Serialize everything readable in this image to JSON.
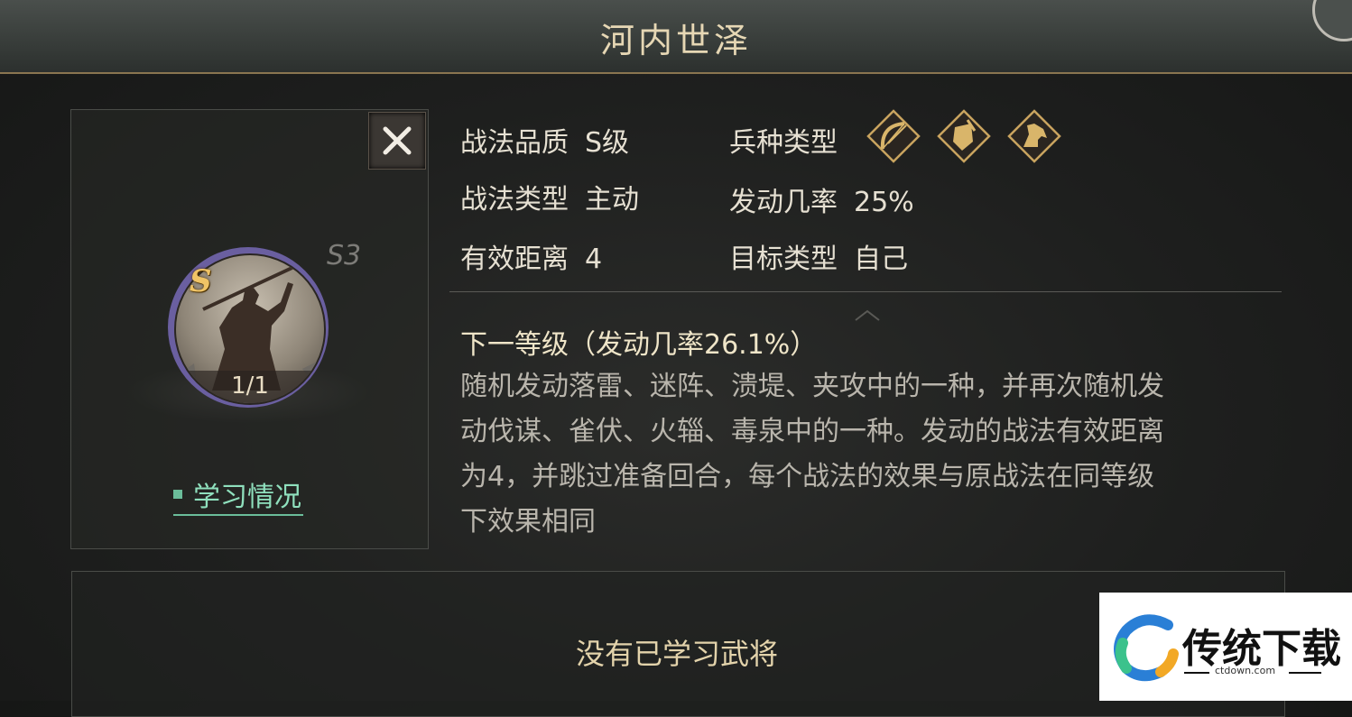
{
  "header": {
    "title": "河内世泽"
  },
  "skill": {
    "grade_badge": "S",
    "level_tag": "S3",
    "count": "1/1",
    "learn_status_label": "学习情况",
    "attributes": {
      "quality_label": "战法品质",
      "quality_value": "S级",
      "type_label": "战法类型",
      "type_value": "主动",
      "range_label": "有效距离",
      "range_value": "4",
      "troop_label": "兵种类型",
      "troop_icons": [
        "bow-troop-icon",
        "shield-troop-icon",
        "horse-troop-icon"
      ],
      "rate_label": "发动几率",
      "rate_value": "25%",
      "target_label": "目标类型",
      "target_value": "自己"
    },
    "next_level": "下一等级（发动几率26.1%）",
    "description_lines": [
      "随机发动落雷、迷阵、溃堤、夹攻中的一种，并再次随机发",
      "动伐谋、雀伏、火辎、毒泉中的一种。发动的战法有效距离",
      "为4，并跳过准备回合，每个战法的效果与原战法在同等级",
      "下效果相同"
    ]
  },
  "learned": {
    "empty_text": "没有已学习武将"
  },
  "watermark": {
    "brand": "传统下载",
    "url": "ctdown.com"
  },
  "colors": {
    "accent_gold": "#e6d7b4",
    "learn_green": "#6bbd9a",
    "portrait_ring": "#6a5fa0"
  }
}
